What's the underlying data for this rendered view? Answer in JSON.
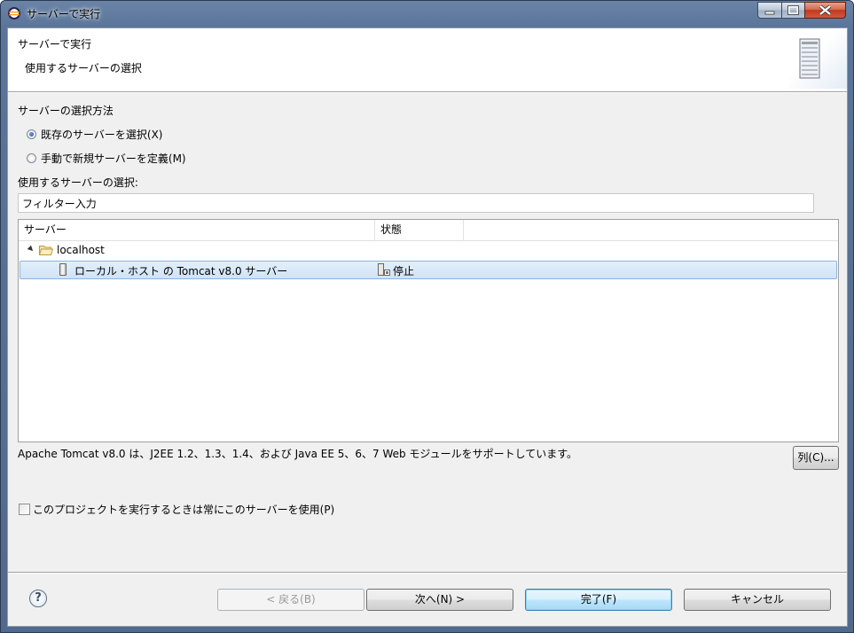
{
  "window": {
    "title": "サーバーで実行",
    "controls": {
      "minimize": "minimize",
      "maximize": "maximize",
      "close": "close"
    }
  },
  "banner": {
    "title": "サーバーで実行",
    "message": "使用するサーバーの選択",
    "graphic_icon": "server-tower-icon"
  },
  "selection_method": {
    "label": "サーバーの選択方法",
    "options": [
      {
        "label": "既存のサーバーを選択(X)",
        "selected": true
      },
      {
        "label": "手動で新規サーバーを定義(M)",
        "selected": false
      }
    ]
  },
  "server_select": {
    "label": "使用するサーバーの選択:",
    "filter_value": "フィルター入力"
  },
  "table": {
    "columns": [
      "サーバー",
      "状態"
    ],
    "tree": {
      "host": "localhost",
      "servers": [
        {
          "name": "ローカル・ホスト の Tomcat v8.0 サーバー",
          "status": "停止",
          "selected": true
        }
      ]
    }
  },
  "description": "Apache Tomcat v8.0 は、J2EE 1.2、1.3、1.4、および Java EE 5、6、7 Web モジュールをサポートしています。",
  "columns_button": "列(C)...",
  "always_use_checkbox": {
    "label": "このプロジェクトを実行するときは常にこのサーバーを使用(P)",
    "checked": false
  },
  "buttons": {
    "back": "< 戻る(B)",
    "next": "次へ(N) >",
    "finish": "完了(F)",
    "cancel": "キャンセル"
  },
  "help_label": "?",
  "colors": {
    "selection": "#cfe3f7",
    "selection_border": "#8fb4dd",
    "dialog_bg": "#f0f0f0"
  }
}
